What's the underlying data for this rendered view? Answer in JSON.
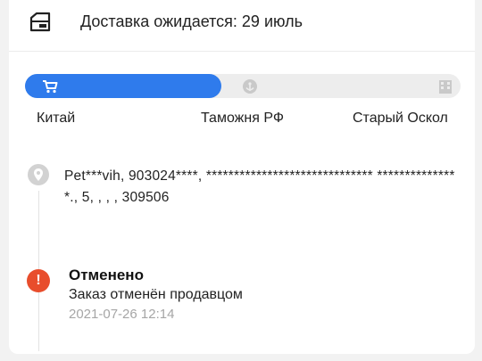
{
  "header": {
    "text": "Доставка ожидается: 29 июль",
    "icon": "delivery-truck-icon"
  },
  "progress": {
    "fraction": 0.45,
    "fill_color": "#2f7bec",
    "track_color": "#ededed",
    "stages": [
      {
        "label": "Китай",
        "icon": "cart-icon",
        "active": true
      },
      {
        "label": "Таможня РФ",
        "icon": "customs-anchor-icon",
        "active": false
      },
      {
        "label": "Старый Оскол",
        "icon": "building-icon",
        "active": false
      }
    ]
  },
  "address": {
    "icon": "location-pin-icon",
    "text": "Pet***vih,  903024****,  ****************************** ***************., 5, , , ,  309506"
  },
  "status": {
    "icon": "alert-icon",
    "icon_color": "#e84d2c",
    "title": "Отменено",
    "description": "Заказ отменён продавцом",
    "timestamp": "2021-07-26 12:14"
  }
}
